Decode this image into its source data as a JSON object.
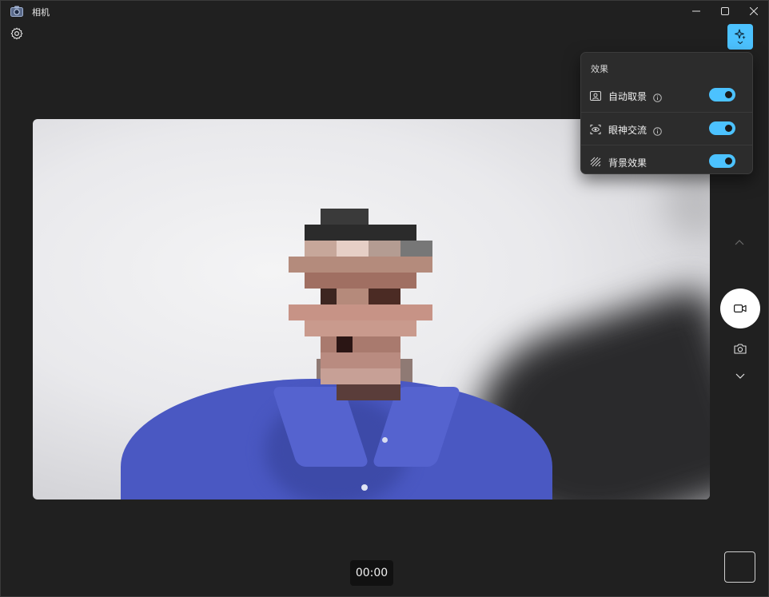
{
  "window": {
    "title": "相机",
    "controls": {
      "minimize": "minimize-icon",
      "maximize": "maximize-icon",
      "close": "close-icon"
    }
  },
  "toolbar": {
    "settings_icon": "gear-icon",
    "effects_icon": "sparkle-icon"
  },
  "effects_panel": {
    "title": "效果",
    "items": [
      {
        "label": "自动取景",
        "icon": "frame-person-icon",
        "info": true,
        "enabled": true
      },
      {
        "label": "眼神交流",
        "icon": "eye-camera-icon",
        "info": true,
        "enabled": true
      },
      {
        "label": "背景效果",
        "icon": "background-blur-icon",
        "info": false,
        "enabled": true
      }
    ]
  },
  "capture_controls": {
    "mode_up": "chevron-up-icon",
    "record": "video-camera-icon",
    "photo": "camera-icon",
    "mode_down": "chevron-down-icon"
  },
  "timer": "00:00",
  "colors": {
    "accent": "#4cc2ff",
    "background": "#202020",
    "panel": "#2c2c2c"
  }
}
